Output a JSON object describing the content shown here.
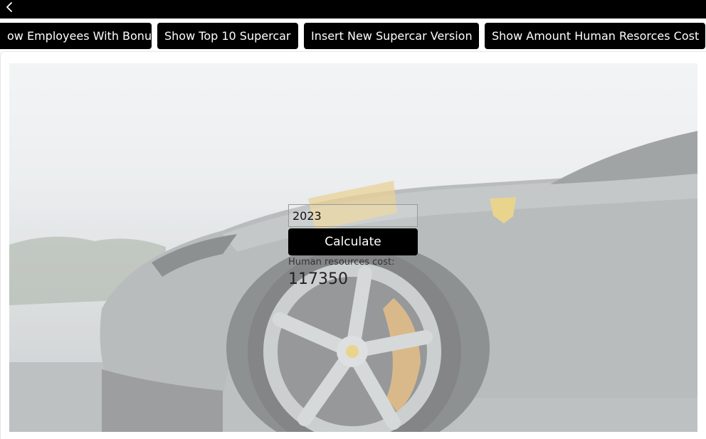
{
  "header": {
    "back_icon": "chevron-left-icon"
  },
  "nav": {
    "buttons": [
      {
        "label": "Show Employees With Bonus",
        "visible_label": "ow Employees With Bonus"
      },
      {
        "label": "Show Top 10 Supercar"
      },
      {
        "label": "Insert New Supercar Version"
      },
      {
        "label": "Show Amount Human Resorces Cost"
      }
    ]
  },
  "form": {
    "year_value": "2023",
    "calculate_label": "Calculate",
    "result_label": "Human resources cost:",
    "result_value": "117350"
  },
  "colors": {
    "bar": "#000000",
    "button_bg": "#000000",
    "button_text": "#ffffff"
  }
}
